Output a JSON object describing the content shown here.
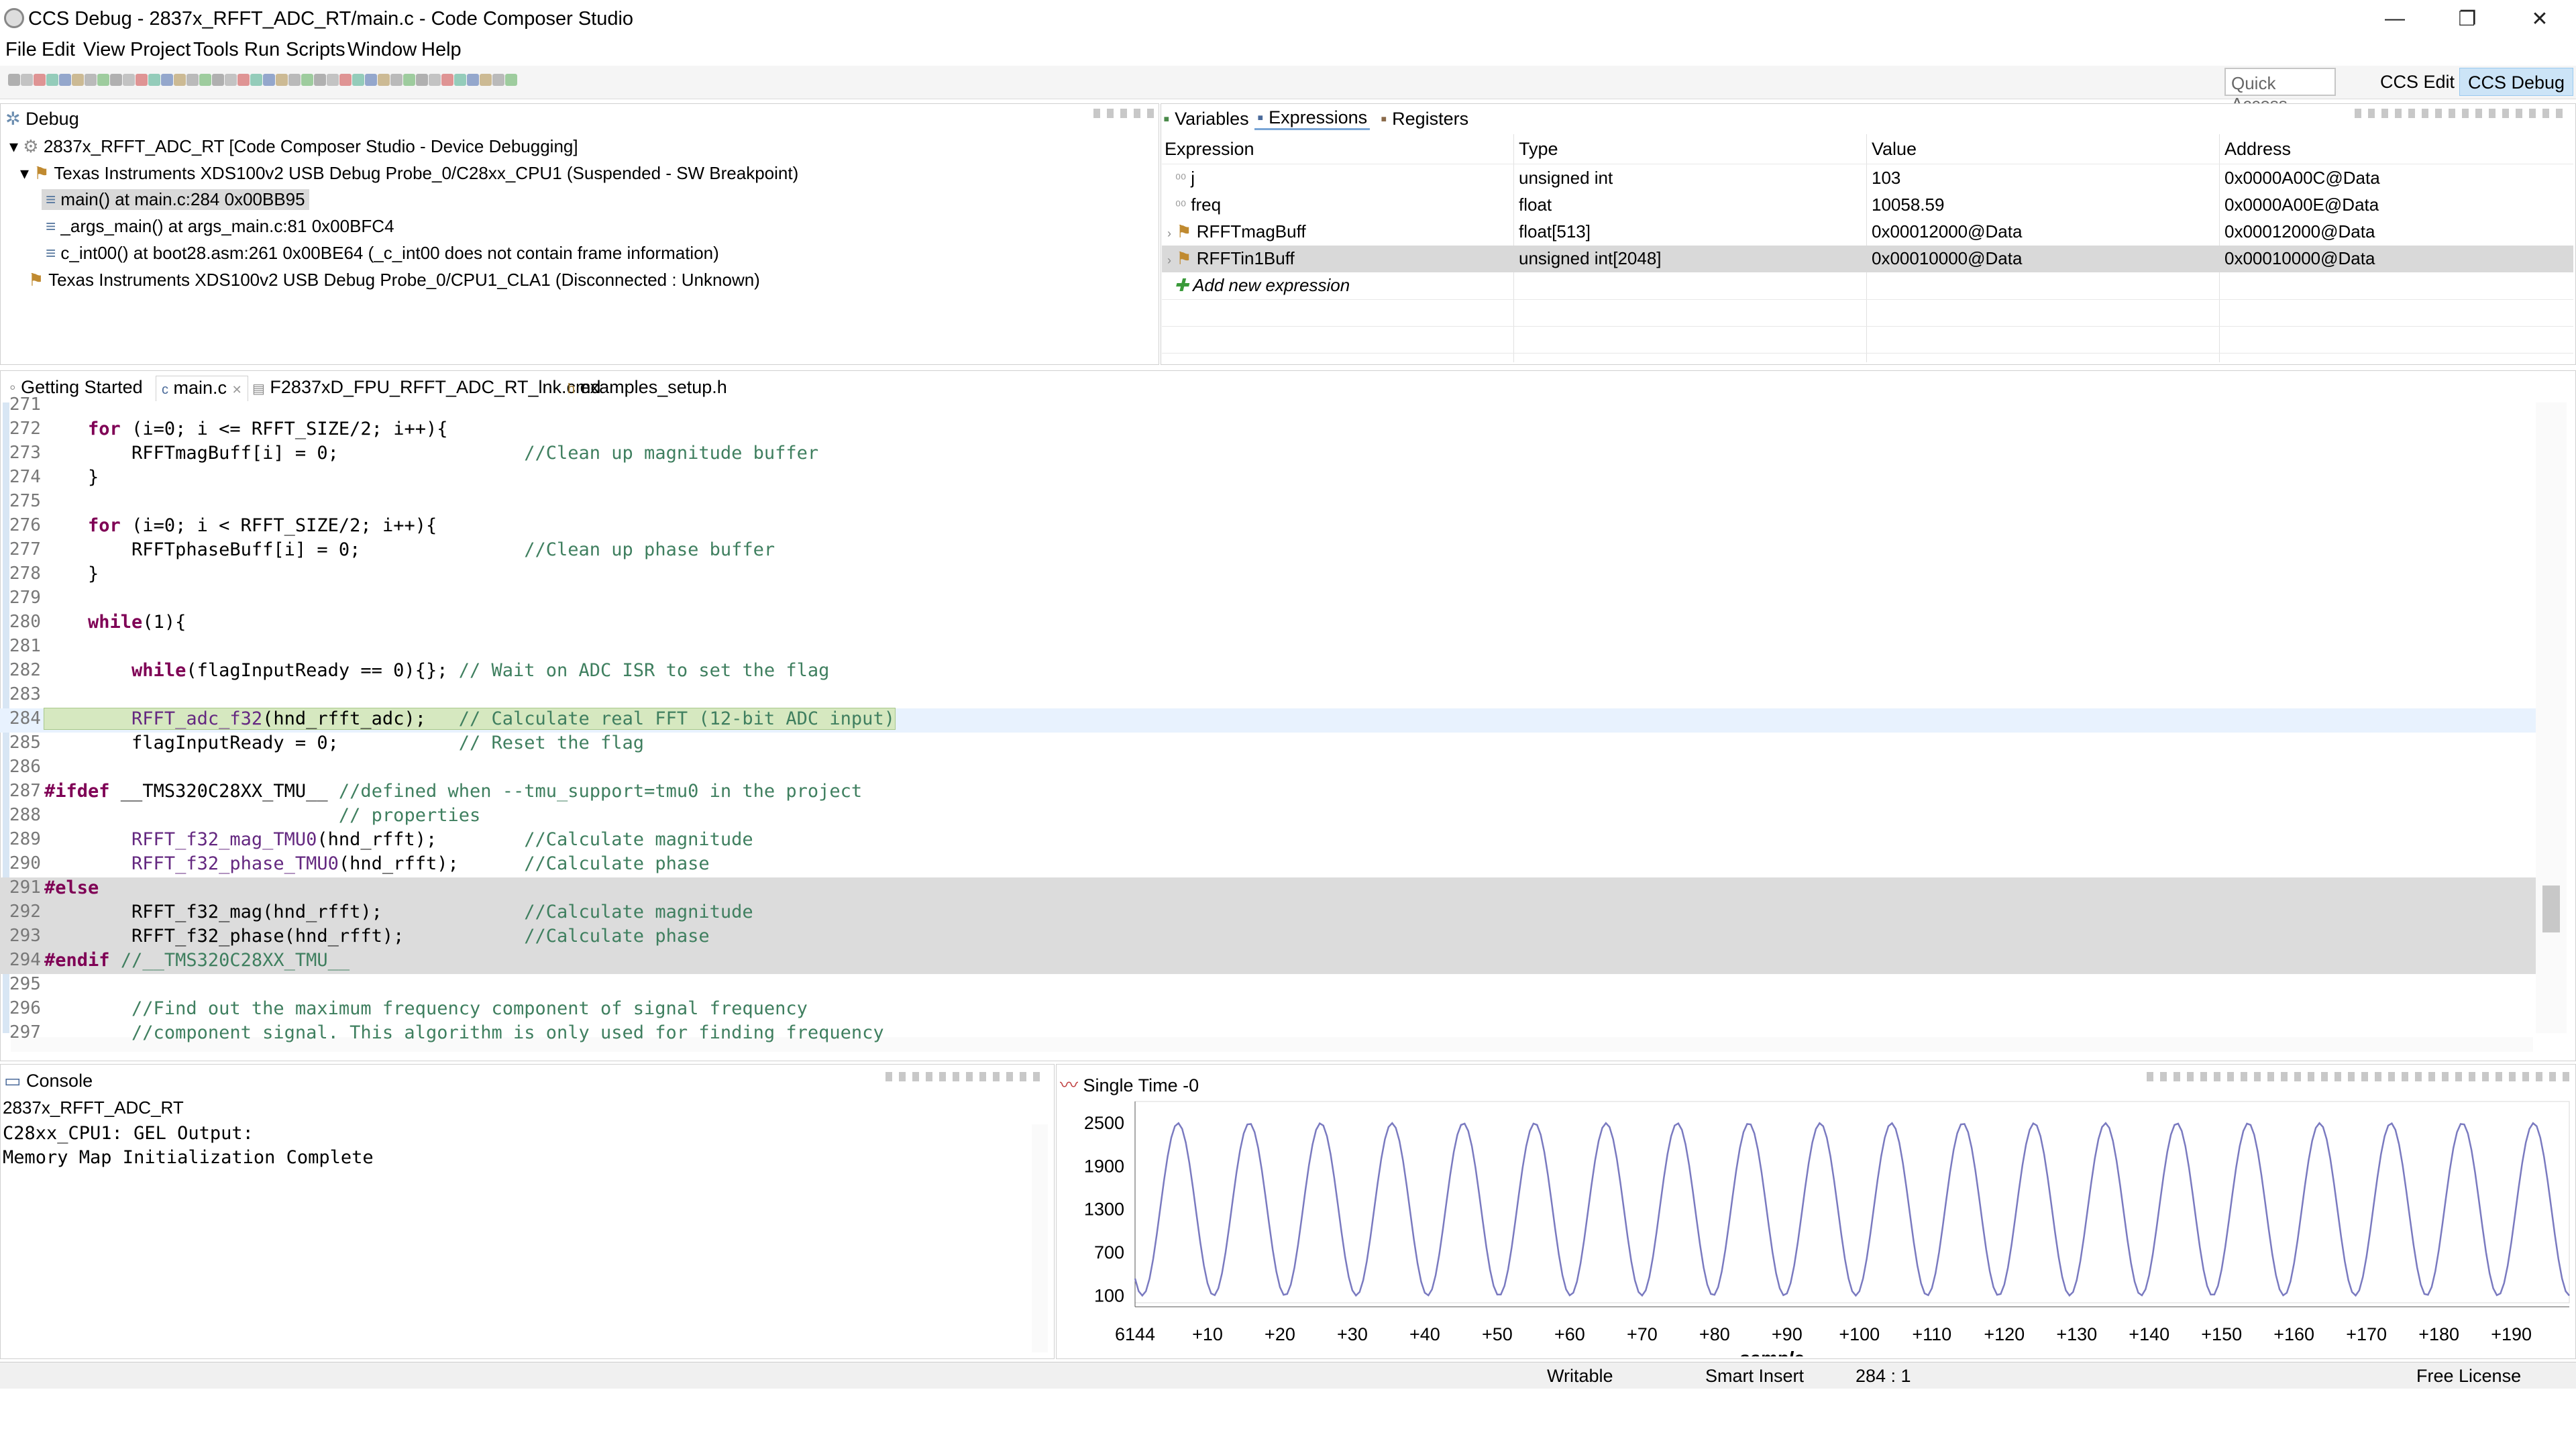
{
  "window": {
    "title": "CCS Debug - 2837x_RFFT_ADC_RT/main.c - Code Composer Studio",
    "minimize": "—",
    "restore": "❐",
    "close": "✕"
  },
  "menu": [
    "File",
    "Edit",
    "View",
    "Project",
    "Tools",
    "Run",
    "Scripts",
    "Window",
    "Help"
  ],
  "toolbar": {
    "quick_access": "Quick Access",
    "perspectives": [
      "CCS Edit",
      "CCS Debug"
    ]
  },
  "debug_view": {
    "tab": "Debug",
    "items": [
      "2837x_RFFT_ADC_RT [Code Composer Studio - Device Debugging]",
      "Texas Instruments XDS100v2 USB Debug Probe_0/C28xx_CPU1 (Suspended - SW Breakpoint)",
      "main() at main.c:284 0x00BB95",
      "_args_main() at args_main.c:81 0x00BFC4",
      "c_int00() at boot28.asm:261 0x00BE64  (_c_int00 does not contain frame information)",
      "Texas Instruments XDS100v2 USB Debug Probe_0/CPU1_CLA1 (Disconnected : Unknown)"
    ]
  },
  "expressions_view": {
    "tabs": [
      "Variables",
      "Expressions",
      "Registers"
    ],
    "columns": [
      "Expression",
      "Type",
      "Value",
      "Address"
    ],
    "rows": [
      {
        "expr": "j",
        "type": "unsigned int",
        "value": "103",
        "address": "0x0000A00C@Data"
      },
      {
        "expr": "freq",
        "type": "float",
        "value": "10058.59",
        "address": "0x0000A00E@Data"
      },
      {
        "expr": "RFFTmagBuff",
        "type": "float[513]",
        "value": "0x00012000@Data",
        "address": "0x00012000@Data"
      },
      {
        "expr": "RFFTin1Buff",
        "type": "unsigned int[2048]",
        "value": "0x00010000@Data",
        "address": "0x00010000@Data"
      }
    ],
    "add_new": "Add new expression"
  },
  "editor": {
    "tabs": [
      "Getting Started",
      "main.c",
      "F2837xD_FPU_RFFT_ADC_RT_lnk.cmd",
      "examples_setup.h"
    ],
    "lines": [
      {
        "n": "271",
        "segs": []
      },
      {
        "n": "272",
        "segs": [
          [
            "",
            "    "
          ],
          [
            "kw",
            "for"
          ],
          [
            "",
            " (i=0; i <= RFFT_SIZE/2; i++){"
          ]
        ]
      },
      {
        "n": "273",
        "segs": [
          [
            "",
            "        RFFTmagBuff[i] = 0;                 "
          ],
          [
            "cm",
            "//Clean up magnitude buffer"
          ]
        ]
      },
      {
        "n": "274",
        "segs": [
          [
            "",
            "    }"
          ]
        ]
      },
      {
        "n": "275",
        "segs": []
      },
      {
        "n": "276",
        "segs": [
          [
            "",
            "    "
          ],
          [
            "kw",
            "for"
          ],
          [
            "",
            " (i=0; i < RFFT_SIZE/2; i++){"
          ]
        ]
      },
      {
        "n": "277",
        "segs": [
          [
            "",
            "        RFFTphaseBuff[i] = 0;               "
          ],
          [
            "cm",
            "//Clean up phase buffer"
          ]
        ]
      },
      {
        "n": "278",
        "segs": [
          [
            "",
            "    }"
          ]
        ]
      },
      {
        "n": "279",
        "segs": []
      },
      {
        "n": "280",
        "segs": [
          [
            "",
            "    "
          ],
          [
            "kw",
            "while"
          ],
          [
            "",
            "(1){"
          ]
        ]
      },
      {
        "n": "281",
        "segs": []
      },
      {
        "n": "282",
        "segs": [
          [
            "",
            "        "
          ],
          [
            "kw",
            "while"
          ],
          [
            "",
            "(flagInputReady == 0){}; "
          ],
          [
            "cm",
            "// Wait on ADC ISR to set the flag"
          ]
        ]
      },
      {
        "n": "283",
        "segs": []
      },
      {
        "n": "284",
        "segs": [
          [
            "",
            "        "
          ],
          [
            "fn",
            "RFFT_adc_f32"
          ],
          [
            "",
            "(hnd_rfft_adc);   "
          ],
          [
            "cm",
            "// Calculate real FFT (12-bit ADC input)"
          ]
        ]
      },
      {
        "n": "285",
        "segs": [
          [
            "",
            "        flagInputReady = 0;           "
          ],
          [
            "cm",
            "// Reset the flag"
          ]
        ]
      },
      {
        "n": "286",
        "segs": []
      },
      {
        "n": "287",
        "segs": [
          [
            "pp",
            "#ifdef"
          ],
          [
            "",
            " __TMS320C28XX_TMU__ "
          ],
          [
            "cm",
            "//defined when --tmu_support=tmu0 in the project"
          ]
        ]
      },
      {
        "n": "288",
        "segs": [
          [
            "",
            "                           "
          ],
          [
            "cm",
            "// properties"
          ]
        ]
      },
      {
        "n": "289",
        "segs": [
          [
            "",
            "        "
          ],
          [
            "fn",
            "RFFT_f32_mag_TMU0"
          ],
          [
            "",
            "(hnd_rfft);        "
          ],
          [
            "cm",
            "//Calculate magnitude"
          ]
        ]
      },
      {
        "n": "290",
        "segs": [
          [
            "",
            "        "
          ],
          [
            "fn",
            "RFFT_f32_phase_TMU0"
          ],
          [
            "",
            "(hnd_rfft);      "
          ],
          [
            "cm",
            "//Calculate phase"
          ]
        ]
      },
      {
        "n": "291",
        "segs": [
          [
            "pp",
            "#else"
          ]
        ]
      },
      {
        "n": "292",
        "segs": [
          [
            "",
            "        RFFT_f32_mag(hnd_rfft);             "
          ],
          [
            "cm",
            "//Calculate magnitude"
          ]
        ]
      },
      {
        "n": "293",
        "segs": [
          [
            "",
            "        RFFT_f32_phase(hnd_rfft);           "
          ],
          [
            "cm",
            "//Calculate phase"
          ]
        ]
      },
      {
        "n": "294",
        "segs": [
          [
            "pp",
            "#endif"
          ],
          [
            "",
            " "
          ],
          [
            "cm",
            "//__TMS320C28XX_TMU__"
          ]
        ]
      },
      {
        "n": "295",
        "segs": []
      },
      {
        "n": "296",
        "segs": [
          [
            "",
            "        "
          ],
          [
            "cm",
            "//Find out the maximum frequency component of signal frequency"
          ]
        ]
      },
      {
        "n": "297",
        "segs": [
          [
            "",
            "        "
          ],
          [
            "cm",
            "//component signal. This algorithm is only used for finding frequency"
          ]
        ]
      }
    ]
  },
  "console": {
    "tab": "Console",
    "project": "2837x_RFFT_ADC_RT",
    "lines": [
      "C28xx_CPU1: GEL Output:",
      "Memory Map Initialization Complete"
    ]
  },
  "graph": {
    "tab": "Single Time -0",
    "line_color": "#7a7ac0"
  },
  "chart_data": {
    "type": "line",
    "title": "",
    "xlabel": "sample",
    "ylabel": "",
    "x_tick_labels": [
      "6144",
      "+10",
      "+20",
      "+30",
      "+40",
      "+50",
      "+60",
      "+70",
      "+80",
      "+90",
      "+100",
      "+110",
      "+120",
      "+130",
      "+140",
      "+150",
      "+160",
      "+170",
      "+180",
      "+190"
    ],
    "y_tick_labels": [
      "2500",
      "1900",
      "1300",
      "700",
      "100"
    ],
    "y_ticks": [
      2500,
      1900,
      1300,
      700,
      100
    ],
    "xlim": [
      6144,
      6342
    ],
    "ylim": [
      0,
      2800
    ],
    "series": [
      {
        "waveform": "sine",
        "period_samples": 9.85,
        "min": 100,
        "max": 2500,
        "x_start": 6144,
        "x_end": 6342
      }
    ]
  },
  "status_bar": [
    "Writable",
    "Smart Insert",
    "284 : 1",
    "Free License"
  ]
}
